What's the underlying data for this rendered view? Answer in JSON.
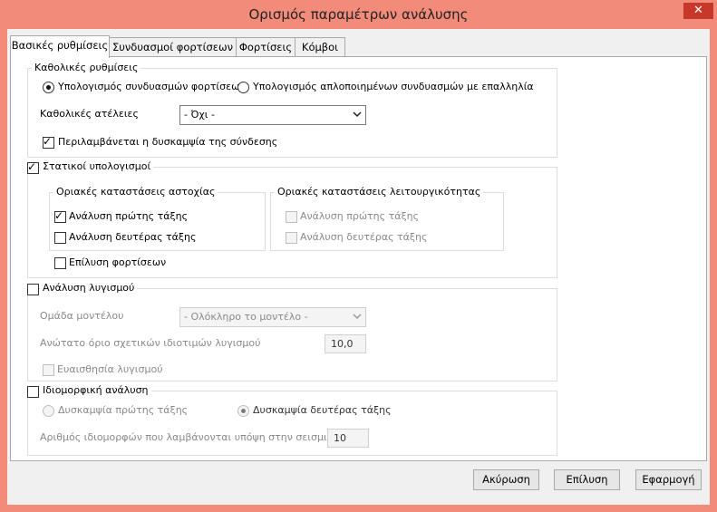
{
  "window": {
    "title": "Ορισμός παραμέτρων ανάλυσης",
    "close_glyph": "✕"
  },
  "tabs": [
    {
      "label": "Βασικές ρυθμίσεις"
    },
    {
      "label": "Συνδυασμοί φορτίσεων"
    },
    {
      "label": "Φορτίσεις"
    },
    {
      "label": "Κόμβοι"
    }
  ],
  "global_settings": {
    "title": "Καθολικές ρυθμίσεις",
    "radio_load_combinations": "Υπολογισμός συνδυασμών φορτίσεων",
    "radio_simplified_combinations": "Υπολογισμός απλοποιημένων συνδυασμών με επαλληλία",
    "imperfections_label": "Καθολικές ατέλειες",
    "imperfections_value": "- Όχι -",
    "include_stiffness_label": "Περιλαμβάνεται η δυσκαμψία της σύνδεσης"
  },
  "static": {
    "title": "Στατικοί υπολογισμοί",
    "uls": {
      "title": "Οριακές καταστάσεις αστοχίας",
      "first_order": "Ανάλυση πρώτης τάξης",
      "second_order": "Ανάλυση δευτέρας τάξης"
    },
    "sls": {
      "title": "Οριακές καταστάσεις λειτουργικότητας",
      "first_order": "Ανάλυση πρώτης τάξης",
      "second_order": "Ανάλυση δευτέρας τάξης"
    },
    "solve_loads": "Επίλυση φορτίσεων"
  },
  "buckling": {
    "title": "Ανάλυση λυγισμού",
    "model_group_label": "Ομάδα μοντέλου",
    "model_group_value": "- Ολόκληρο το μοντέλο -",
    "max_eigen_label": "Ανώτατο όριο σχετικών ιδιοτιμών λυγισμού",
    "max_eigen_value": "10,0",
    "sensitivity_label": "Ευαισθησία λυγισμού"
  },
  "modal": {
    "title": "Ιδιομορφική ανάλυση",
    "radio_first_order": "Δυσκαμψία πρώτης τάξης",
    "radio_second_order": "Δυσκαμψία δευτέρας τάξης",
    "modes_label": "Αριθμός ιδιομορφών που λαμβάνονται υπόψη στην σεισμική",
    "modes_value": "10"
  },
  "buttons": {
    "cancel": "Ακύρωση",
    "solve": "Επίλυση",
    "apply": "Εφαρμογή"
  },
  "colors": {
    "titlebar": "#f38b7a",
    "close": "#c7382b"
  }
}
